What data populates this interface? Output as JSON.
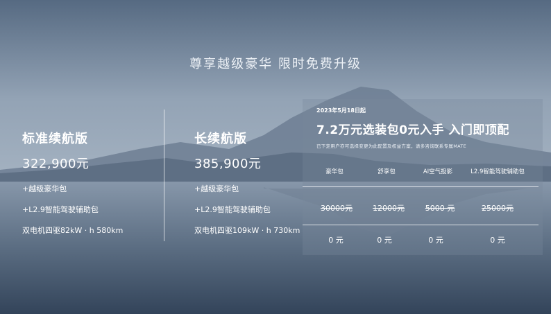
{
  "headline": "尊享越级豪华 限时免费升级",
  "variants": [
    {
      "name": "标准续航版",
      "price": "322,900元",
      "feature1": "+越级豪华包",
      "feature2": "+L2.9智能驾驶辅助包",
      "spec": "双电机四驱82kW · h  580km"
    },
    {
      "name": "长续航版",
      "price": "385,900元",
      "feature1": "+越级豪华包",
      "feature2": "+L2.9智能驾驶辅助包",
      "spec": "双电机四驱109kW · h  730km"
    }
  ],
  "promo": {
    "date": "2023年5月18日起",
    "title": "7.2万元选装包0元入手  入门即顶配",
    "note": "已下定用户亦可选择变更为此配置及权益方案，请多咨询联系专属MATE",
    "packages": [
      {
        "name": "豪华包",
        "original": "30000元",
        "now": "0 元"
      },
      {
        "name": "舒享包",
        "original": "12000元",
        "now": "0 元"
      },
      {
        "name": "AI空气投影",
        "original": "5000 元",
        "now": "0 元"
      },
      {
        "name": "L2.9智能驾驶辅助包",
        "original": "25000元",
        "now": "0 元"
      }
    ]
  }
}
